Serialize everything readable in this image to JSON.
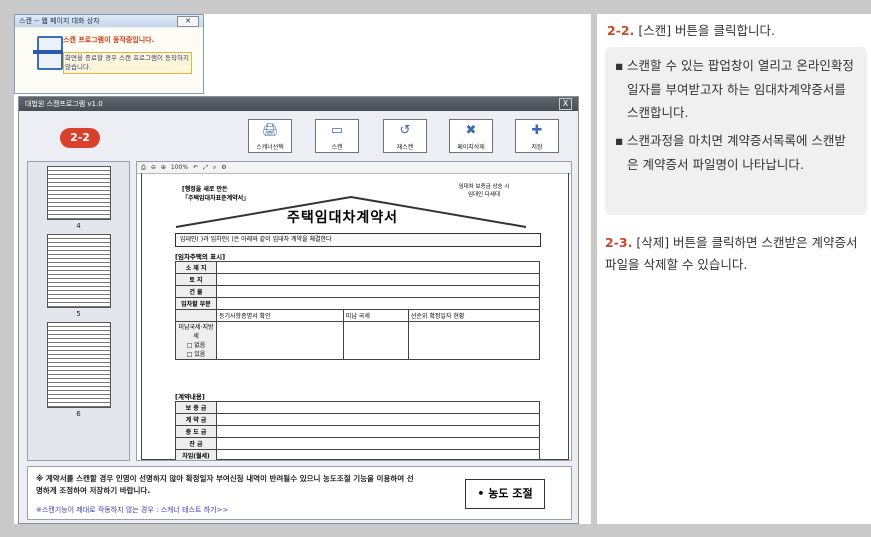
{
  "popup": {
    "title": "스캔 -- 웹 페이지 대화 상자",
    "line1": "스캔 프로그램이 동작중입니다.",
    "line2": "화면을 종료할 경우 스캔 프로그램이 동작하지 않습니다."
  },
  "window": {
    "title": "대법원 스캔프로그램 v1.0",
    "close_label": "X",
    "step_badge": "2-2",
    "toolbar": [
      {
        "label": "스캐너선택",
        "icon": "scanner-select-icon",
        "glyph": "🖨"
      },
      {
        "label": "스캔",
        "icon": "scan-icon",
        "glyph": "▭"
      },
      {
        "label": "재스캔",
        "icon": "rescan-icon",
        "glyph": "↺"
      },
      {
        "label": "페이지삭제",
        "icon": "page-delete-icon",
        "glyph": "✖"
      },
      {
        "label": "저장",
        "icon": "save-icon",
        "glyph": "✚"
      }
    ],
    "thumb_numbers": [
      "4",
      "5",
      "6"
    ],
    "doc_toolbar_zoom": "100%",
    "doc": {
      "header_small_1": "[행정을 새로 만든",
      "header_small_2": "「주택임대차표준계약서」",
      "stamp_1": "임대차 보증금 상승 시",
      "stamp_2": "임대인 다세대",
      "title": "주택임대차계약서",
      "intro": "임대인(                  )과 임차인(                  )은 아래와 같이 임대차 계약을 체결한다",
      "section1": "[임차주택의 표시]",
      "section2": "[계약내용]",
      "rows1": [
        "소 재 지",
        "토 지",
        "건 물",
        "임차할 부분"
      ],
      "row1_extra": [
        "미납 국세",
        "선순위 확정일자 현황",
        "등기사항증명서 확인"
      ],
      "side_label": "미납국세·지방세",
      "check1": "□ 없음",
      "check2": "□ 있음",
      "rows2": [
        "보 증 금",
        "계 약 금",
        "중 도 금",
        "잔 금",
        "차임(월세)"
      ]
    },
    "notice": "※ 계약서를 스캔할 경우 인영이 선명하지 않아 확정일자 부여신청 내역이 반려될수 있으니 농도조절 기능을 이용하여 선명하게 조정하여 저장하기 바랍니다.",
    "test_link": "※스캔기능이 제대로 작동하지 않는 경우 : 스캐너 테스트 하기>>",
    "density_button": "• 농도 조절"
  },
  "instructions": {
    "step1_num": "2-2.",
    "step1_text": "[스캔] 버튼을 클릭합니다.",
    "bullets": [
      "스캔할 수 있는 팝업창이 열리고 온라인확정일자를 부여받고자 하는 임대차계약증서를 스캔합니다.",
      "스캔과정을 마치면 계약증서목록에 스캔받은 계약증서 파일명이 나타납니다."
    ],
    "step2_num": "2-3.",
    "step2_text": "[삭제] 버튼을 클릭하면 스캔받은 계약증서 파일을 삭제할 수 있습니다."
  }
}
